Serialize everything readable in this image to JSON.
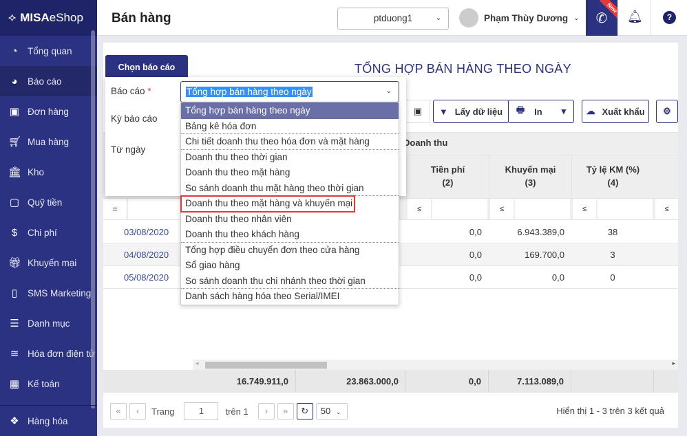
{
  "app": {
    "logo": "MISA eShop",
    "logo_bold": "MISA",
    "logo_rest": "eShop",
    "page_title": "Bán hàng"
  },
  "sidebar": {
    "items": [
      {
        "label": "Tổng quan",
        "icon": "dashboard-icon"
      },
      {
        "label": "Báo cáo",
        "icon": "pie-chart-icon",
        "active": true
      },
      {
        "label": "Đơn hàng",
        "icon": "truck-icon"
      },
      {
        "label": "Mua hàng",
        "icon": "cart-icon"
      },
      {
        "label": "Kho",
        "icon": "bank-icon"
      },
      {
        "label": "Quỹ tiền",
        "icon": "safe-icon"
      },
      {
        "label": "Chi phí",
        "icon": "money-bag-icon"
      },
      {
        "label": "Khuyến mại",
        "icon": "gift-icon"
      },
      {
        "label": "SMS Marketing",
        "icon": "phone-icon"
      },
      {
        "label": "Danh mục",
        "icon": "list-icon"
      },
      {
        "label": "Hóa đơn điện tử",
        "icon": "invoice-icon"
      },
      {
        "label": "Kế toán",
        "icon": "calculator-icon"
      }
    ],
    "bottom": {
      "label": "Hàng hóa",
      "icon": "boxes-icon"
    }
  },
  "header": {
    "store": "ptduong1",
    "user": "Phạm Thùy Dương",
    "new_badge": "New"
  },
  "report": {
    "title": "TỔNG HỢP BÁN HÀNG THEO NGÀY",
    "buttons": {
      "fetch": "Lấy dữ liệu",
      "print": "In",
      "export": "Xuất khẩu"
    }
  },
  "chooser": {
    "tab": "Chọn báo cáo",
    "report_label": "Báo cáo",
    "required": "*",
    "period_label": "Kỳ báo cáo",
    "from_label": "Từ ngày",
    "selected": "Tổng hợp bán hàng theo ngày",
    "options": [
      "Tổng hợp bán hàng theo ngày",
      "Bảng kê hóa đơn",
      "Chi tiết doanh thu theo hóa đơn và mặt hàng",
      "Doanh thu theo thời gian",
      "Doanh thu theo mặt hàng",
      "So sánh doanh thu mặt hàng theo thời gian",
      "Doanh thu theo mặt hàng và khuyến mại",
      "Doanh thu theo nhân viên",
      "Doanh thu theo khách hàng",
      "Tổng hợp điều chuyển đơn theo cửa hàng",
      "Sổ giao hàng",
      "So sánh doanh thu chi nhánh theo thời gian",
      "Danh sách hàng hóa theo Serial/IMEI"
    ],
    "highlighted_index": 6
  },
  "table": {
    "group_header": "Doanh thu",
    "columns": [
      {
        "name": "Tiền phí",
        "num": "(2)"
      },
      {
        "name": "Khuyến mại",
        "num": "(3)"
      },
      {
        "name": "Tỷ lệ KM (%)",
        "num": "(4)"
      }
    ],
    "filter_eq": "=",
    "filter_le": "≤",
    "rows": [
      {
        "date": "03/08/2020",
        "fee": "0,0",
        "promo": "6.943.389,0",
        "rate": "38"
      },
      {
        "date": "04/08/2020",
        "fee": "0,0",
        "promo": "169.700,0",
        "rate": "3"
      },
      {
        "date": "05/08/2020",
        "fee": "0,0",
        "promo": "0,0",
        "rate": "0"
      }
    ],
    "totals": [
      "16.749.911,0",
      "23.863.000,0",
      "0,0",
      "7.113.089,0"
    ]
  },
  "pager": {
    "page_label": "Trang",
    "page": "1",
    "of_label": "trên 1",
    "page_size": "50",
    "result": "Hiển thị 1 - 3 trên 3 kết quả"
  }
}
